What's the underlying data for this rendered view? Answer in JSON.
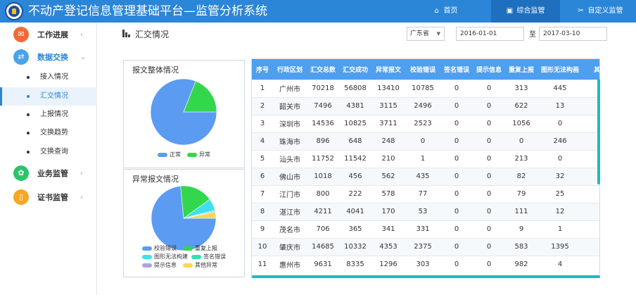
{
  "header": {
    "title": "不动产登记信息管理基础平台—监管分析系统",
    "nav": [
      {
        "label": "首页",
        "icon": "home-icon",
        "glyph": "⌂"
      },
      {
        "label": "综合监管",
        "icon": "monitor-icon",
        "glyph": "▣"
      },
      {
        "label": "自定义监管",
        "icon": "tools-icon",
        "glyph": "✂"
      }
    ]
  },
  "sidebar": {
    "groups": [
      {
        "label": "工作进展",
        "icon": "mail-icon",
        "glyph": "✉",
        "color": "#f06a35",
        "chevron": "‹"
      },
      {
        "label": "数据交换",
        "icon": "shuffle-icon",
        "glyph": "⇄",
        "color": "#4aa3e8",
        "chevron": "⌄"
      },
      {
        "label": "业务监管",
        "icon": "gear-icon",
        "glyph": "✿",
        "color": "#2cc36b",
        "chevron": "‹"
      },
      {
        "label": "证书监管",
        "icon": "certificate-icon",
        "glyph": "▯",
        "color": "#f5a623",
        "chevron": "‹"
      }
    ],
    "sub_items": [
      "接入情况",
      "汇交情况",
      "上报情况",
      "交换趋势",
      "交换查询"
    ]
  },
  "page": {
    "title": "汇交情况",
    "region": "广东省",
    "date_from": "2016-01-01",
    "date_sep": "至",
    "date_to": "2017-03-10"
  },
  "panels": {
    "overall_title": "报文整体情况",
    "abnormal_title": "异常报文情况"
  },
  "chart_data": [
    {
      "type": "pie",
      "title": "报文整体情况",
      "labels": [
        "正常",
        "异常"
      ],
      "values": [
        81,
        19
      ],
      "colors": [
        "#5b9cf2",
        "#32d74b"
      ]
    },
    {
      "type": "pie",
      "title": "异常报文情况",
      "labels": [
        "校验错误",
        "重复上报",
        "图形无法构建",
        "签名错误",
        "提示信息",
        "其他异常"
      ],
      "values": [
        73.5,
        16.5,
        6,
        0.5,
        0.5,
        3
      ],
      "colors": [
        "#5b9cf2",
        "#32d74b",
        "#3fdff0",
        "#2ee3b0",
        "#b49ee8",
        "#f7d94c"
      ]
    }
  ],
  "table": {
    "columns": [
      "序号",
      "行政区划",
      "汇交总数",
      "汇交成功",
      "异常报文",
      "校验错误",
      "签名错误",
      "提示信息",
      "重复上报",
      "图形无法构画",
      "其他"
    ],
    "rows": [
      [
        "1",
        "广州市",
        "70218",
        "56808",
        "13410",
        "10785",
        "0",
        "0",
        "313",
        "445"
      ],
      [
        "2",
        "韶关市",
        "7496",
        "4381",
        "3115",
        "2496",
        "0",
        "0",
        "622",
        "13"
      ],
      [
        "3",
        "深圳市",
        "14536",
        "10825",
        "3711",
        "2523",
        "0",
        "0",
        "1056",
        "0"
      ],
      [
        "4",
        "珠海市",
        "896",
        "648",
        "248",
        "0",
        "0",
        "0",
        "0",
        "246"
      ],
      [
        "5",
        "汕头市",
        "11752",
        "11542",
        "210",
        "1",
        "0",
        "0",
        "213",
        "0"
      ],
      [
        "6",
        "佛山市",
        "1018",
        "456",
        "562",
        "435",
        "0",
        "0",
        "82",
        "32"
      ],
      [
        "7",
        "江门市",
        "800",
        "222",
        "578",
        "77",
        "0",
        "0",
        "79",
        "25"
      ],
      [
        "8",
        "湛江市",
        "4211",
        "4041",
        "170",
        "53",
        "0",
        "0",
        "111",
        "12"
      ],
      [
        "9",
        "茂名市",
        "706",
        "365",
        "341",
        "331",
        "0",
        "0",
        "9",
        "1"
      ],
      [
        "10",
        "肇庆市",
        "14685",
        "10332",
        "4353",
        "2375",
        "0",
        "0",
        "583",
        "1395"
      ],
      [
        "11",
        "惠州市",
        "9631",
        "8335",
        "1296",
        "303",
        "0",
        "0",
        "982",
        "4"
      ]
    ]
  }
}
